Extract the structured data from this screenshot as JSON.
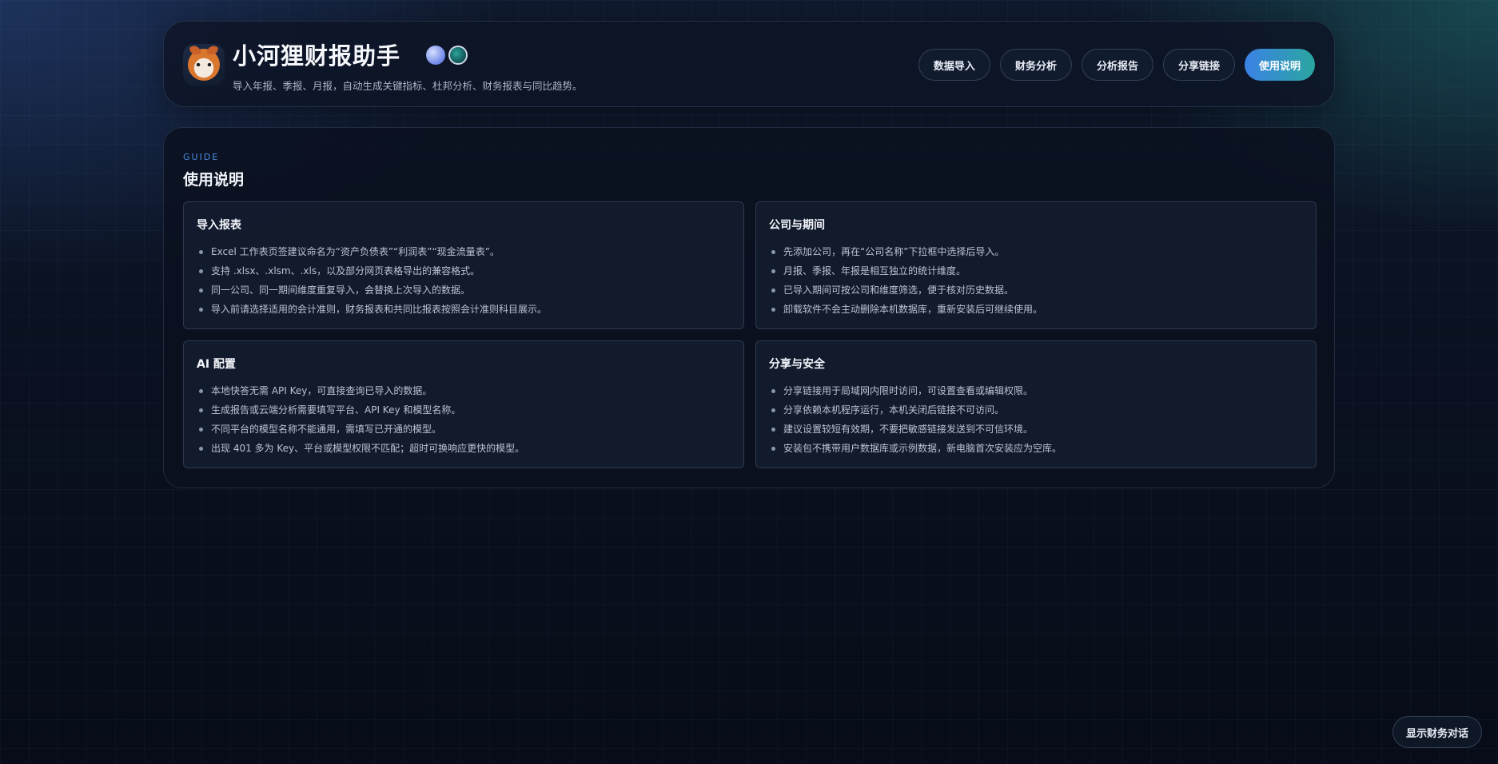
{
  "app": {
    "title": "小河狸财报助手",
    "subtitle": "导入年报、季报、月报，自动生成关键指标、杜邦分析、财务报表与同比趋势。",
    "logo_icon": "beaver-mascot-icon"
  },
  "nav": {
    "items": [
      {
        "label": "数据导入",
        "active": false
      },
      {
        "label": "财务分析",
        "active": false
      },
      {
        "label": "分析报告",
        "active": false
      },
      {
        "label": "分享链接",
        "active": false
      },
      {
        "label": "使用说明",
        "active": true
      }
    ]
  },
  "guide": {
    "eyebrow": "GUIDE",
    "title": "使用说明",
    "cards": [
      {
        "title": "导入报表",
        "items": [
          "Excel 工作表页签建议命名为“资产负债表”“利润表”“现金流量表”。",
          "支持 .xlsx、.xlsm、.xls，以及部分网页表格导出的兼容格式。",
          "同一公司、同一期间维度重复导入，会替换上次导入的数据。",
          "导入前请选择适用的会计准则，财务报表和共同比报表按照会计准则科目展示。"
        ]
      },
      {
        "title": "公司与期间",
        "items": [
          "先添加公司，再在“公司名称”下拉框中选择后导入。",
          "月报、季报、年报是相互独立的统计维度。",
          "已导入期间可按公司和维度筛选，便于核对历史数据。",
          "卸载软件不会主动删除本机数据库，重新安装后可继续使用。"
        ]
      },
      {
        "title": "AI 配置",
        "items": [
          "本地快答无需 API Key，可直接查询已导入的数据。",
          "生成报告或云端分析需要填写平台、API Key 和模型名称。",
          "不同平台的模型名称不能通用，需填写已开通的模型。",
          "出现 401 多为 Key、平台或模型权限不匹配；超时可换响应更快的模型。"
        ]
      },
      {
        "title": "分享与安全",
        "items": [
          "分享链接用于局域网内限时访问，可设置查看或编辑权限。",
          "分享依赖本机程序运行，本机关闭后链接不可访问。",
          "建议设置较短有效期，不要把敏感链接发送到不可信环境。",
          "安装包不携带用户数据库或示例数据，新电脑首次安装应为空库。"
        ]
      }
    ]
  },
  "floating": {
    "label": "显示财务对话"
  },
  "colors": {
    "accent_start": "#3b82e6",
    "accent_end": "#2aa6a0",
    "eyebrow": "#4d8de8"
  }
}
